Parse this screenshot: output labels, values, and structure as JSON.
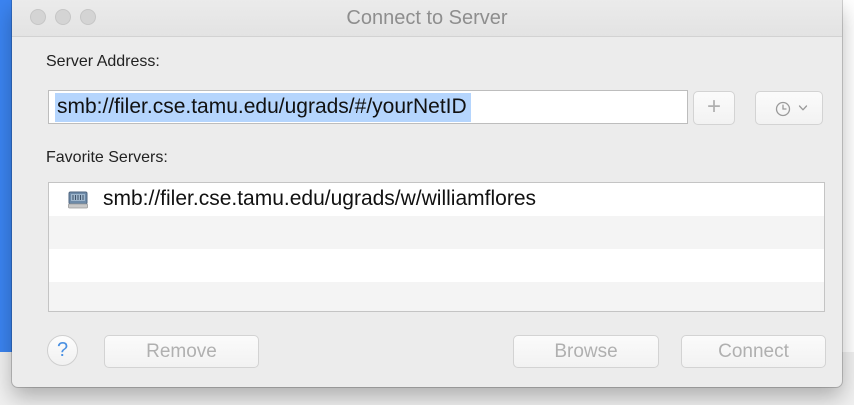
{
  "window": {
    "title": "Connect to Server"
  },
  "server": {
    "label": "Server Address:",
    "value": "smb://filer.cse.tamu.edu/ugrads/#/yourNetID",
    "add_label": "+",
    "recent_icon": "clock-icon",
    "recent_chevron_icon": "chevron-down-icon"
  },
  "favorites": {
    "label": "Favorite Servers:",
    "items": [
      {
        "icon": "server-icon",
        "label": "smb://filer.cse.tamu.edu/ugrads/w/williamflores"
      }
    ]
  },
  "buttons": {
    "help": "?",
    "remove": "Remove",
    "browse": "Browse",
    "connect": "Connect"
  },
  "colors": {
    "selection": "#b5d5fd",
    "help_accent": "#4a90e2",
    "disabled_text": "#b0b0b0",
    "desktop_accent": "#3b84f1"
  }
}
